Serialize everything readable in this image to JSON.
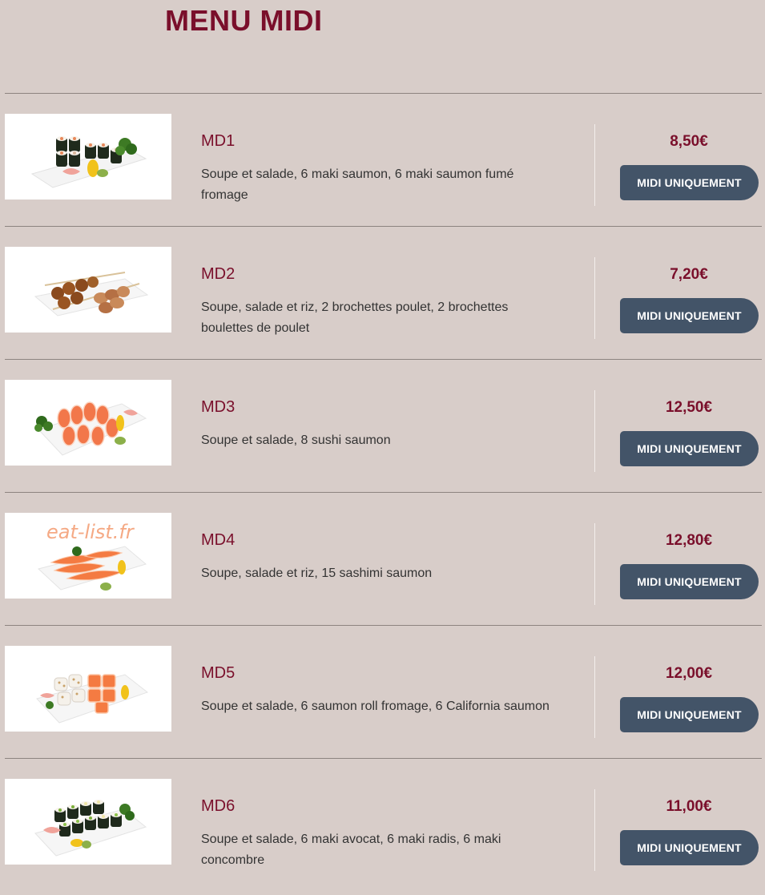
{
  "page": {
    "title": "MENU MIDI"
  },
  "colors": {
    "background": "#d8cdc9",
    "title": "#7a0f2b",
    "button": "#435468",
    "button_text": "#ffffff"
  },
  "menu": {
    "items": [
      {
        "name": "MD1",
        "description": "Soupe et salade, 6 maki saumon, 6 maki saumon fumé fromage",
        "price": "8,50€",
        "button_label": "MIDI UNIQUEMENT",
        "image": "maki-platter"
      },
      {
        "name": "MD2",
        "description": "Soupe, salade et riz, 2 brochettes poulet, 2 brochettes boulettes de poulet",
        "price": "7,20€",
        "button_label": "MIDI UNIQUEMENT",
        "image": "chicken-skewers"
      },
      {
        "name": "MD3",
        "description": "Soupe et salade, 8 sushi saumon",
        "price": "12,50€",
        "button_label": "MIDI UNIQUEMENT",
        "image": "salmon-sushi"
      },
      {
        "name": "MD4",
        "description": "Soupe, salade et riz, 15 sashimi saumon",
        "price": "12,80€",
        "button_label": "MIDI UNIQUEMENT",
        "image": "salmon-sashimi",
        "watermark": "eat-list.fr"
      },
      {
        "name": "MD5",
        "description": "Soupe et salade, 6 saumon roll fromage, 6 California saumon",
        "price": "12,00€",
        "button_label": "MIDI UNIQUEMENT",
        "image": "california-rolls"
      },
      {
        "name": "MD6",
        "description": "Soupe et salade, 6 maki avocat, 6 maki radis, 6 maki concombre",
        "price": "11,00€",
        "button_label": "MIDI UNIQUEMENT",
        "image": "maki-assortment"
      }
    ]
  }
}
